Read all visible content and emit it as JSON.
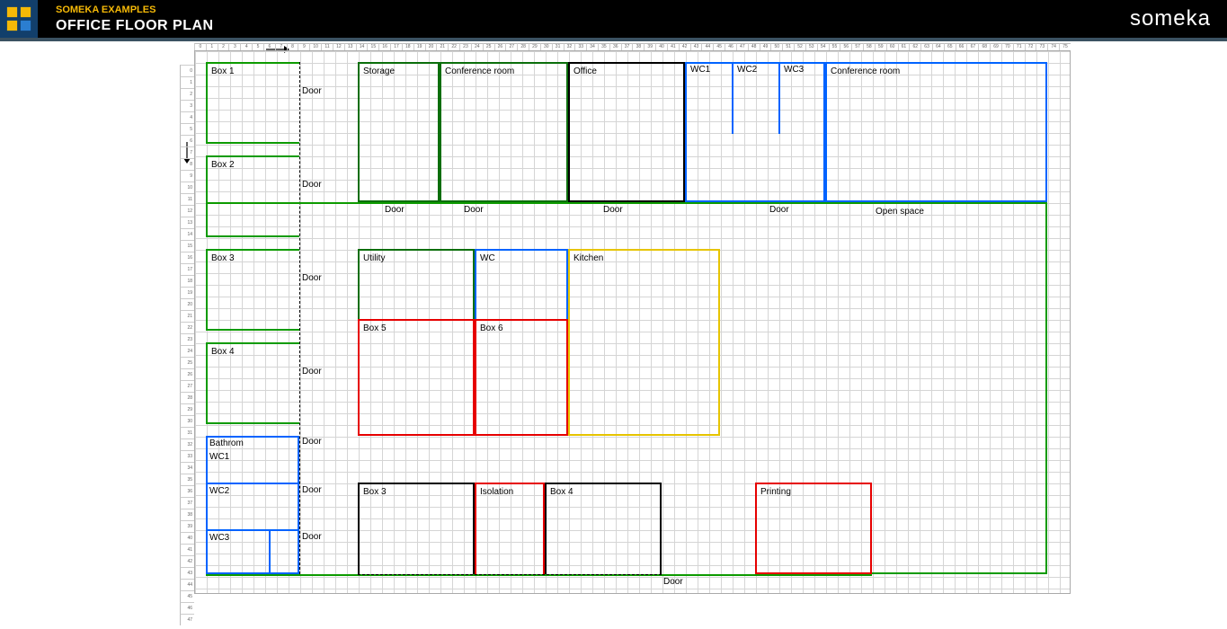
{
  "header": {
    "breadcrumb": "SOMEKA EXAMPLES",
    "title": "OFFICE FLOOR PLAN",
    "brand": "someka"
  },
  "grid": {
    "cols": 75,
    "rows": 47,
    "cell": 13
  },
  "rulers": {
    "top": [
      "0",
      "1",
      "2",
      "3",
      "4",
      "5",
      "6",
      "7",
      "8",
      "9",
      "10",
      "11",
      "12",
      "13",
      "14",
      "15",
      "16",
      "17",
      "18",
      "19",
      "20",
      "21",
      "22",
      "23",
      "24",
      "25",
      "26",
      "27",
      "28",
      "29",
      "30",
      "31",
      "32",
      "33",
      "34",
      "35",
      "36",
      "37",
      "38",
      "39",
      "40",
      "41",
      "42",
      "43",
      "44",
      "45",
      "46",
      "47",
      "48",
      "49",
      "50",
      "51",
      "52",
      "53",
      "54",
      "55",
      "56",
      "57",
      "58",
      "59",
      "60",
      "61",
      "62",
      "63",
      "64",
      "65",
      "66",
      "67",
      "68",
      "69",
      "70",
      "71",
      "72",
      "73",
      "74",
      "75"
    ],
    "left": [
      "0",
      "1",
      "2",
      "3",
      "4",
      "5",
      "6",
      "7",
      "8",
      "9",
      "10",
      "11",
      "12",
      "13",
      "14",
      "15",
      "16",
      "17",
      "18",
      "19",
      "20",
      "21",
      "22",
      "23",
      "24",
      "25",
      "26",
      "27",
      "28",
      "29",
      "30",
      "31",
      "32",
      "33",
      "34",
      "35",
      "36",
      "37",
      "38",
      "39",
      "40",
      "41",
      "42",
      "43",
      "44",
      "45",
      "46",
      "47"
    ]
  },
  "rooms": {
    "box1": "Box 1",
    "box2": "Box 2",
    "box3": "Box 3",
    "box4": "Box 4",
    "box5": "Box 5",
    "box6": "Box  6",
    "storage": "Storage",
    "conf1": "Conference room",
    "office": "Office",
    "wc1": "WC1",
    "wc2": "WC2",
    "wc3": "WC3",
    "conf2": "Conference room",
    "openspace": "Open space",
    "utility": "Utility",
    "wc": "WC",
    "kitchen": "Kitchen",
    "bathroom": "Bathrom",
    "bathroom_wc1": "WC1",
    "wc2b": "WC2",
    "wc3b": "WC3",
    "box3b": "Box 3",
    "isolation": "Isolation",
    "box4b": "Box 4",
    "printing": "Printing"
  },
  "doors": {
    "d": "Door"
  }
}
